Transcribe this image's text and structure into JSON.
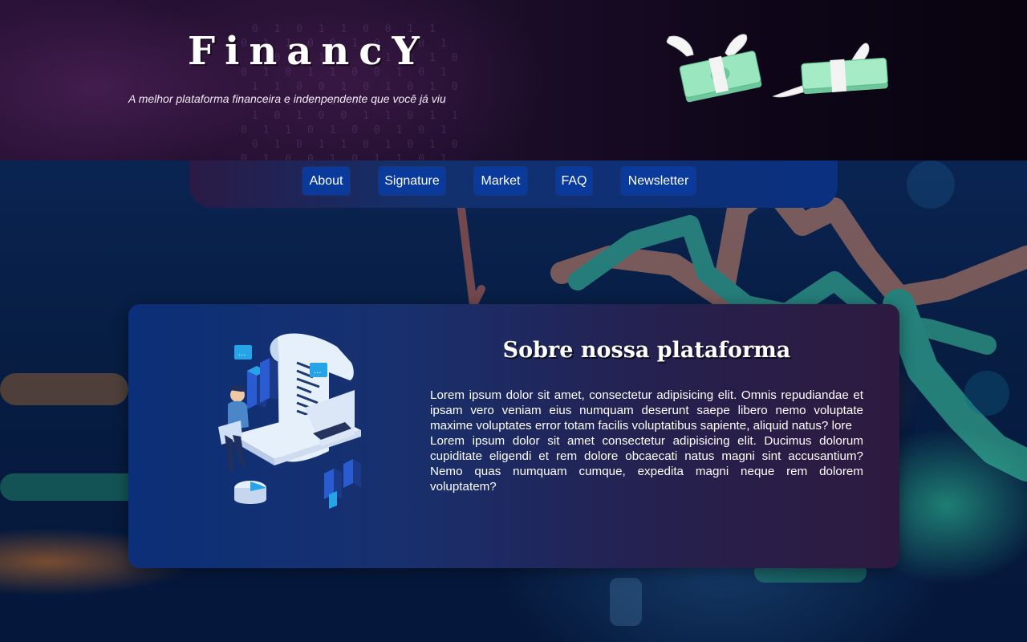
{
  "header": {
    "brand": "FinancY",
    "tagline": "A melhor plataforma financeira e indenpendente que você já viu"
  },
  "nav": {
    "items": [
      "About",
      "Signature",
      "Market",
      "FAQ",
      "Newsletter"
    ]
  },
  "about": {
    "title": "Sobre nossa plataforma",
    "paragraph1": "Lorem ipsum dolor sit amet, consectetur adipisicing elit. Omnis repudiandae et ipsam vero veniam eius numquam deserunt saepe libero nemo voluptate maxime voluptates error totam facilis voluptatibus sapiente, aliquid natus? lore",
    "paragraph2": "Lorem ipsum dolor sit amet consectetur adipisicing elit. Ducimus dolorum cupiditate eligendi et rem dolore obcaecati natus magni sint accusantium? Nemo quas numquam cumque, expedita magni neque rem dolorem voluptatem?"
  },
  "icons": {
    "money_left": "flying-money-icon",
    "money_right": "flying-money-icon",
    "illustration": "finance-report-illustration"
  },
  "colors": {
    "nav_button": "#0a3a9c",
    "money_green": "#8fe0b0"
  }
}
